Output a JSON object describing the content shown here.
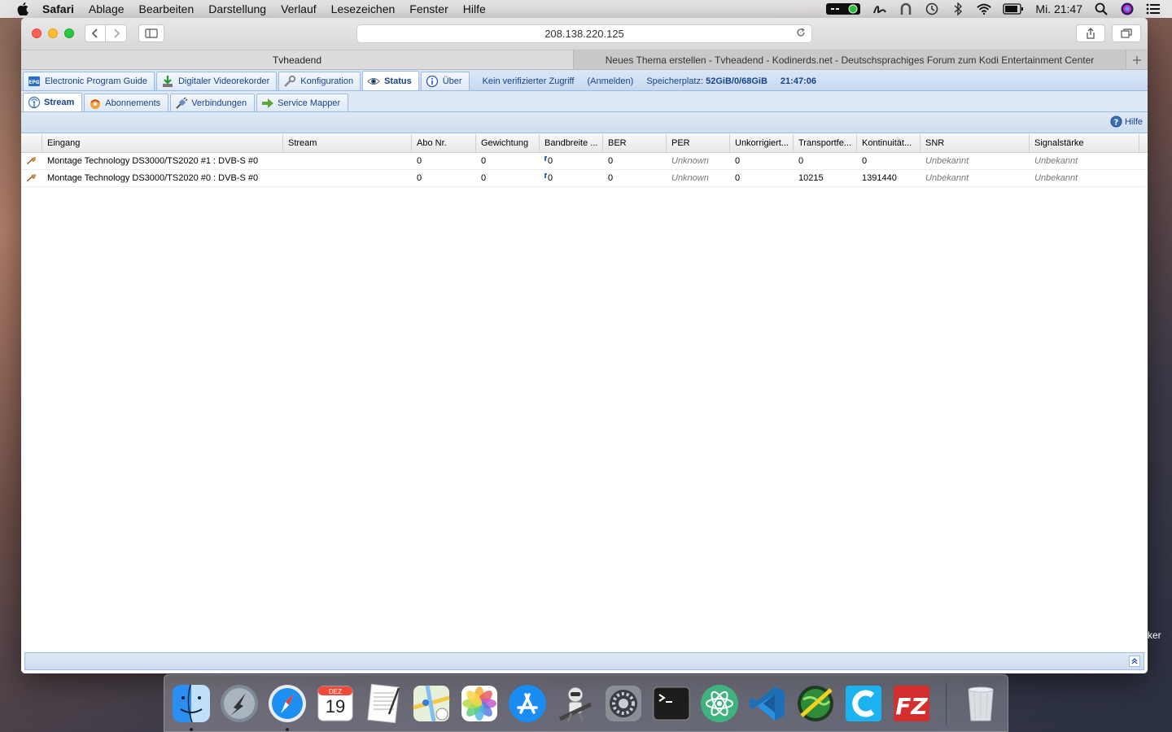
{
  "menubar": {
    "app": "Safari",
    "items": [
      "Ablage",
      "Bearbeiten",
      "Darstellung",
      "Verlauf",
      "Lesezeichen",
      "Fenster",
      "Hilfe"
    ],
    "clock": "Mi. 21:47"
  },
  "browser": {
    "url": "208.138.220.125",
    "tabs": [
      {
        "label": "Tvheadend"
      },
      {
        "label": "Neues Thema erstellen - Tvheadend - Kodinerds.net - Deutschsprachiges Forum zum Kodi Entertainment Center"
      }
    ]
  },
  "tvh": {
    "main_tabs": [
      {
        "label": "Electronic Program Guide"
      },
      {
        "label": "Digitaler Videorekorder"
      },
      {
        "label": "Konfiguration"
      },
      {
        "label": "Status"
      },
      {
        "label": "Über"
      }
    ],
    "status": {
      "access": "Kein verifizierter Zugriff",
      "login": "(Anmelden)",
      "storage_label": "Speicherplatz:",
      "storage_value": "52GiB/0/68GiB",
      "time": "21:47:06"
    },
    "sub_tabs": [
      {
        "label": "Stream"
      },
      {
        "label": "Abonnements"
      },
      {
        "label": "Verbindungen"
      },
      {
        "label": "Service Mapper"
      }
    ],
    "help": "Hilfe",
    "columns": [
      "Eingang",
      "Stream",
      "Abo Nr.",
      "Gewichtung",
      "Bandbreite ...",
      "BER",
      "PER",
      "Unkorrigiert...",
      "Transportfe...",
      "Kontinuität...",
      "SNR",
      "Signalstärke"
    ],
    "rows": [
      {
        "input": "Montage Technology DS3000/TS2020 #1 : DVB-S #0",
        "stream": "",
        "subs": "0",
        "weight": "0",
        "bw": "0",
        "ber": "0",
        "per": "Unknown",
        "unc": "0",
        "te": "0",
        "cc": "0",
        "snr": "Unbekannt",
        "signal": "Unbekannt"
      },
      {
        "input": "Montage Technology DS3000/TS2020 #0 : DVB-S #0",
        "stream": "",
        "subs": "0",
        "weight": "0",
        "bw": "0",
        "ber": "0",
        "per": "Unknown",
        "unc": "0",
        "te": "10215",
        "cc": "1391440",
        "snr": "Unbekannt",
        "signal": "Unbekannt"
      }
    ]
  },
  "dock": {
    "items": [
      "finder-icon",
      "launchpad-icon",
      "safari-icon",
      "calendar-icon",
      "textedit-icon",
      "maps-icon",
      "photos-icon",
      "appstore-icon",
      "automator-icon",
      "system-preferences-icon",
      "terminal-icon",
      "atom-icon",
      "vscode-icon",
      "globe-app-icon",
      "c-app-icon",
      "filezilla-icon",
      "trash-icon"
    ],
    "calendar_month": "DEZ",
    "calendar_day": "19"
  },
  "desktop": {
    "side_text": "ker"
  }
}
